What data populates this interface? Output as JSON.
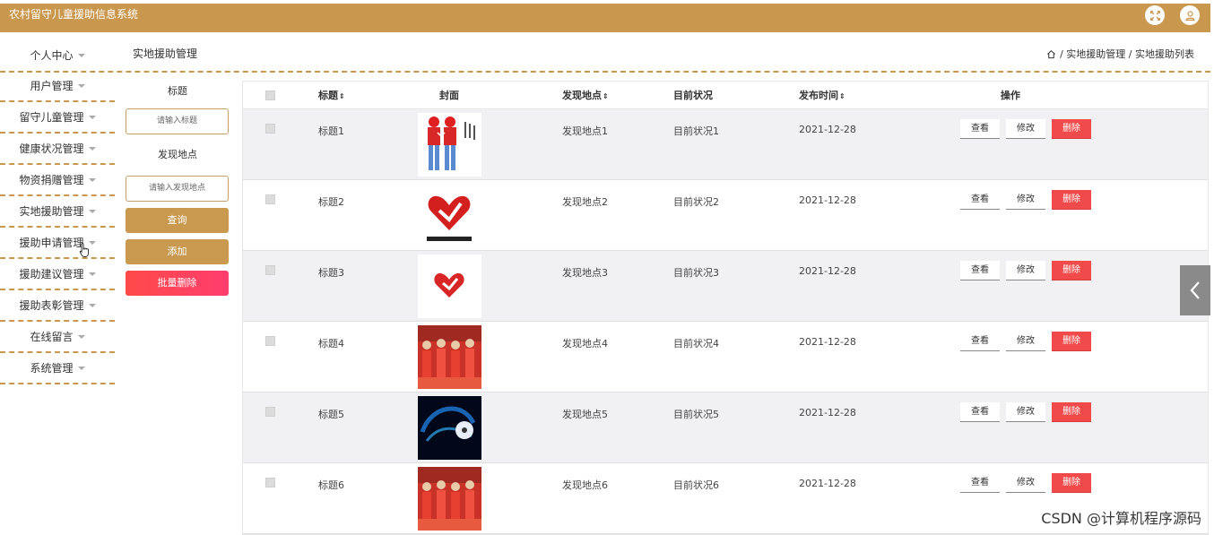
{
  "app": {
    "title": "农村留守儿童援助信息系统"
  },
  "header": {
    "fullscreen_icon": "fullscreen-icon",
    "user_icon": "user-icon"
  },
  "page": {
    "title": "实地援助管理"
  },
  "breadcrumb": {
    "home_icon": "home-icon",
    "text": "/ 实地援助管理 / 实地援助列表"
  },
  "sidebar": {
    "items": [
      {
        "label": "个人中心"
      },
      {
        "label": "用户管理"
      },
      {
        "label": "留守儿童管理"
      },
      {
        "label": "健康状况管理"
      },
      {
        "label": "物资捐赠管理"
      },
      {
        "label": "实地援助管理"
      },
      {
        "label": "援助申请管理"
      },
      {
        "label": "援助建议管理"
      },
      {
        "label": "援助表彰管理"
      },
      {
        "label": "在线留言"
      },
      {
        "label": "系统管理"
      }
    ]
  },
  "search": {
    "title_label": "标题",
    "title_placeholder": "请输入标题",
    "location_label": "发现地点",
    "location_placeholder": "请输入发现地点",
    "query_button": "查询",
    "add_button": "添加",
    "batch_delete_button": "批量删除"
  },
  "table": {
    "headers": {
      "title": "标题",
      "cover": "封面",
      "location": "发现地点",
      "status": "目前状况",
      "time": "发布时间",
      "ops": "操作"
    },
    "sort_glyph": "⇕",
    "ops": {
      "view": "查看",
      "edit": "修改",
      "delete": "删除"
    },
    "rows": [
      {
        "title": "标题1",
        "location": "发现地点1",
        "status": "目前状况1",
        "time": "2021-12-28"
      },
      {
        "title": "标题2",
        "location": "发现地点2",
        "status": "目前状况2",
        "time": "2021-12-28"
      },
      {
        "title": "标题3",
        "location": "发现地点3",
        "status": "目前状况3",
        "time": "2021-12-28"
      },
      {
        "title": "标题4",
        "location": "发现地点4",
        "status": "目前状况4",
        "time": "2021-12-28"
      },
      {
        "title": "标题5",
        "location": "发现地点5",
        "status": "目前状况5",
        "time": "2021-12-28"
      },
      {
        "title": "标题6",
        "location": "发现地点6",
        "status": "目前状况6",
        "time": "2021-12-28"
      }
    ]
  },
  "watermark": "CSDN @计算机程序源码",
  "colors": {
    "accent": "#ca974f",
    "danger": "#f04a4a"
  }
}
